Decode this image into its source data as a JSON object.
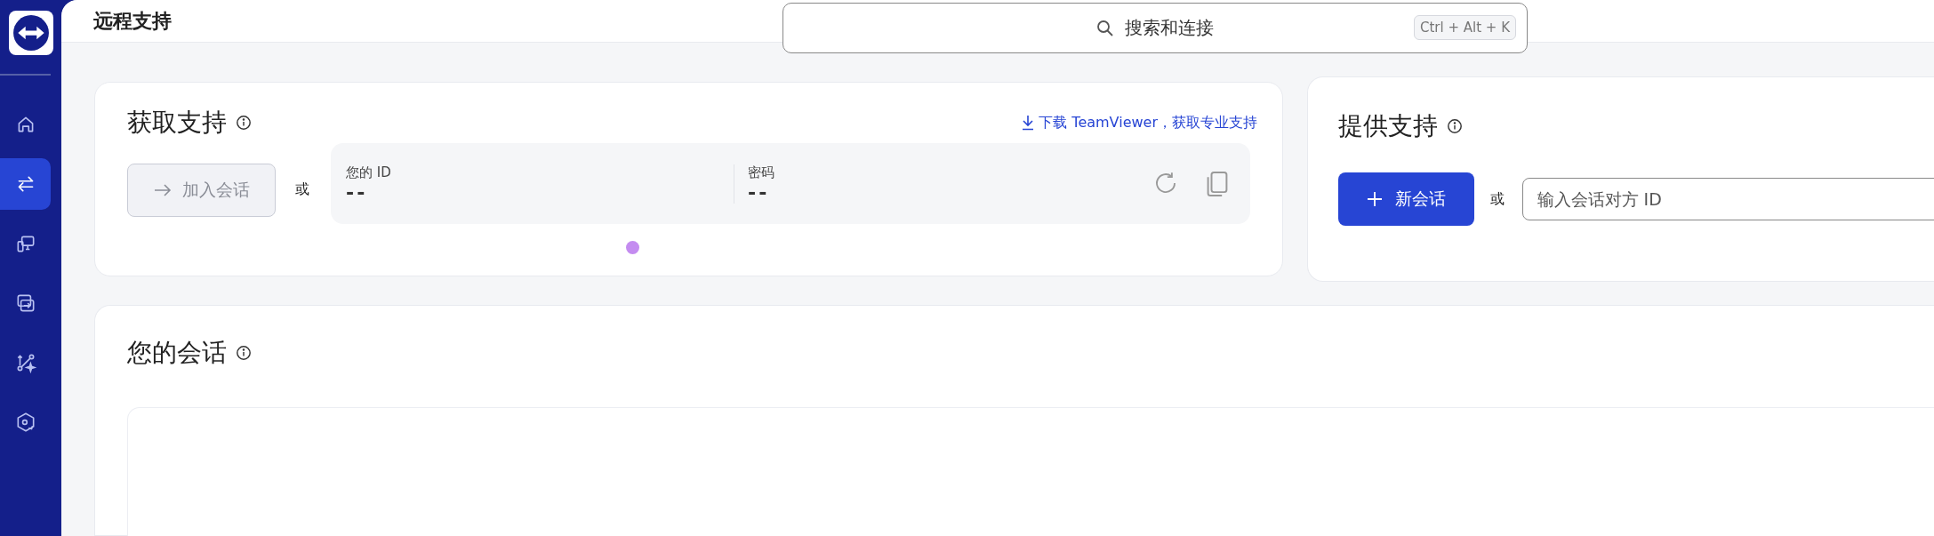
{
  "sidebar": {
    "items": [
      {
        "kind": "home",
        "selected": false
      },
      {
        "kind": "swap",
        "selected": true
      },
      {
        "kind": "devices",
        "selected": false
      },
      {
        "kind": "screen",
        "selected": false
      },
      {
        "kind": "flow",
        "selected": false
      },
      {
        "kind": "hexagon",
        "selected": false
      }
    ]
  },
  "header": {
    "title": "远程支持",
    "search": {
      "placeholder": "搜索和连接",
      "shortcut": "Ctrl + Alt + K"
    }
  },
  "get_support": {
    "title": "获取支持",
    "download_link": "下载 TeamViewer，获取专业支持",
    "join_button": {
      "label": "加入会话",
      "disabled": true
    },
    "or": "或",
    "id_label": "您的 ID",
    "id_value": "--",
    "password_label": "密码",
    "password_value": "--"
  },
  "provide_support": {
    "title": "提供支持",
    "new_session_button": "新会话",
    "or": "或",
    "partner_id": {
      "placeholder": "输入会话对方 ID"
    }
  },
  "sessions": {
    "title": "您的会话"
  }
}
